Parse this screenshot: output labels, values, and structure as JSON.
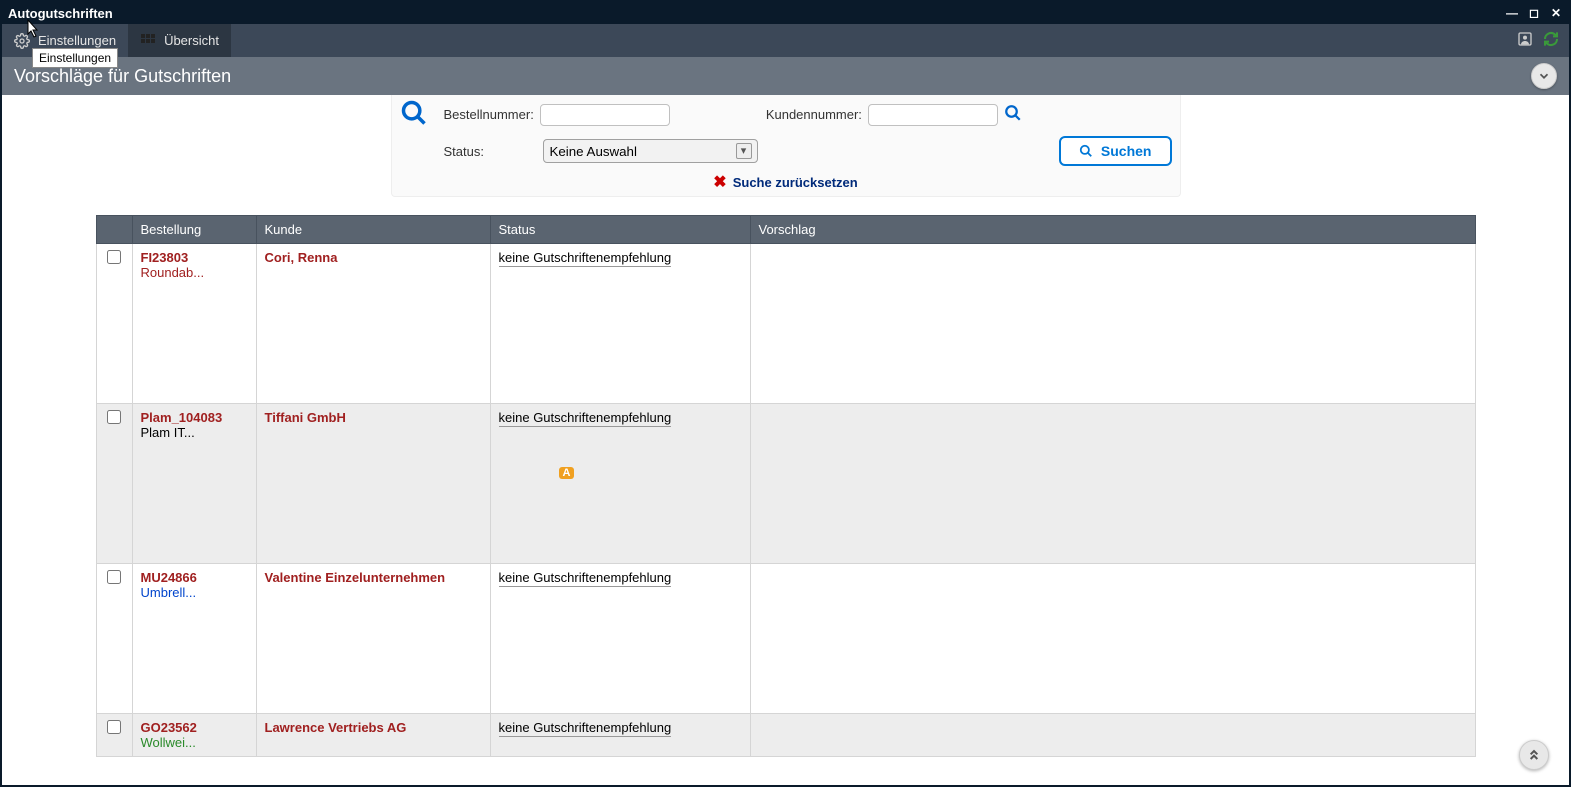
{
  "window": {
    "title": "Autogutschriften"
  },
  "toolbar": {
    "settings_tab": "Einstellungen",
    "overview_tab": "Übersicht",
    "tooltip": "Einstellungen"
  },
  "subheader": {
    "title": "Vorschläge für Gutschriften"
  },
  "search": {
    "order_label": "Bestellnummer:",
    "customer_label": "Kundennummer:",
    "status_label": "Status:",
    "status_placeholder": "Keine Auswahl",
    "search_button": "Suchen",
    "reset_label": "Suche zurücksetzen"
  },
  "table": {
    "headers": {
      "order": "Bestellung",
      "customer": "Kunde",
      "status": "Status",
      "proposal": "Vorschlag"
    },
    "rows": [
      {
        "order_id": "FI23803",
        "order_sub": "Roundab...",
        "sub_class": "red",
        "customer": "Cori, Renna",
        "status": "keine Gutschriftenempfehlung",
        "badge": "",
        "alt": false,
        "height": "row-tall"
      },
      {
        "order_id": "Plam_104083",
        "order_sub": "Plam IT...",
        "sub_class": "",
        "customer": "Tiffani GmbH",
        "status": "keine Gutschriftenempfehlung",
        "badge": "A",
        "alt": true,
        "height": "row-tall"
      },
      {
        "order_id": "MU24866",
        "order_sub": "Umbrell...",
        "sub_class": "blue",
        "customer": "Valentine Einzelunternehmen",
        "status": "keine Gutschriftenempfehlung",
        "badge": "",
        "alt": false,
        "height": "row-med"
      },
      {
        "order_id": "GO23562",
        "order_sub": "Wollwei...",
        "sub_class": "green",
        "customer": "Lawrence Vertriebs AG",
        "status": "keine Gutschriftenempfehlung",
        "badge": "",
        "alt": true,
        "height": ""
      }
    ]
  }
}
